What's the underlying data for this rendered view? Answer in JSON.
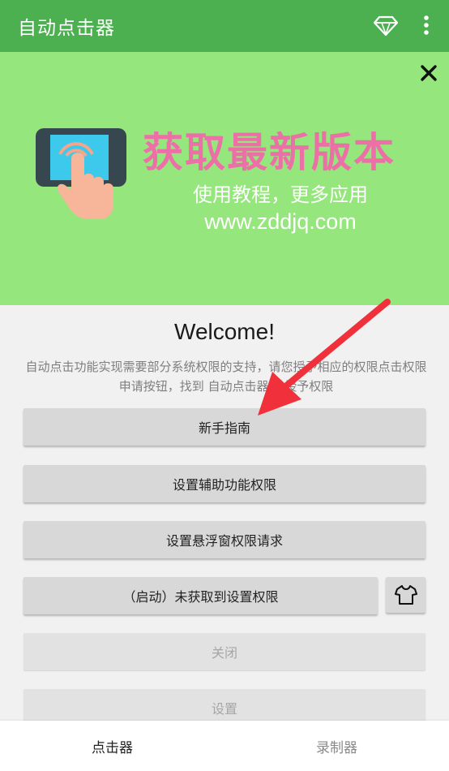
{
  "appbar": {
    "title": "自动点击器",
    "bg": "#4caf50"
  },
  "banner": {
    "headline": "获取最新版本",
    "subtitle": "使用教程，更多应用",
    "url": "www.zddjq.com",
    "bg": "#95e67c",
    "headline_color": "#ec6fa8"
  },
  "main": {
    "welcome": "Welcome!",
    "description": "自动点击功能实现需要部分系统权限的支持，请您授予相应的权限点击权限申请按钮，找到 自动点击器 并授予权限",
    "buttons": {
      "guide": "新手指南",
      "accessibility": "设置辅助功能权限",
      "overlay": "设置悬浮窗权限请求",
      "start": "（启动）未获取到设置权限",
      "close": "关闭",
      "settings": "设置"
    }
  },
  "bottom_nav": {
    "tabs": [
      {
        "label": "点击器",
        "active": true
      },
      {
        "label": "录制器",
        "active": false
      }
    ]
  },
  "icons": {
    "diamond": "diamond-icon",
    "more": "more-vertical-icon",
    "close": "close-icon",
    "shirt": "shirt-icon"
  }
}
